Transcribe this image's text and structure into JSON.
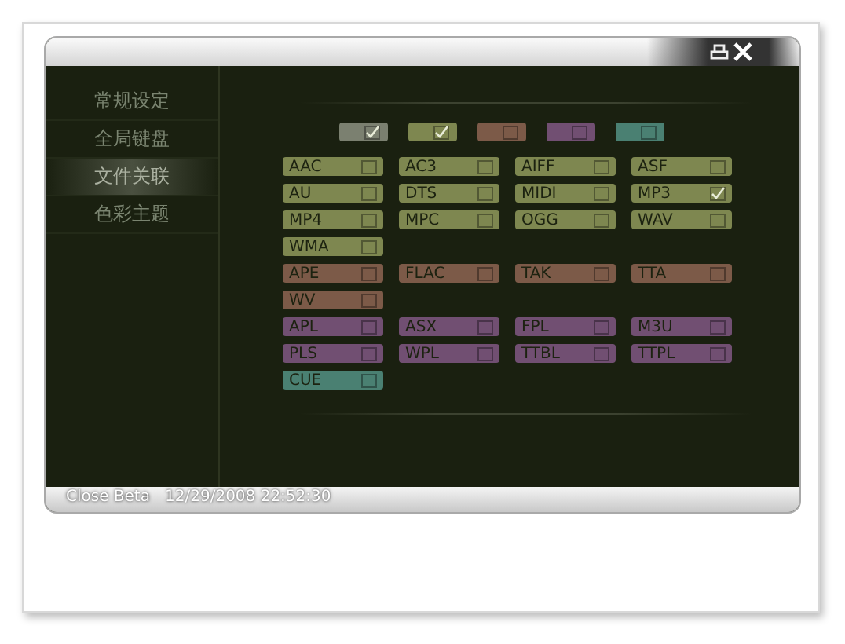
{
  "window": {
    "title_buttons": [
      {
        "kind": "restore"
      },
      {
        "kind": "close"
      }
    ]
  },
  "sidebar": {
    "items": [
      {
        "label": "常规设定",
        "selected": false
      },
      {
        "label": "全局键盘",
        "selected": false
      },
      {
        "label": "文件关联",
        "selected": true
      },
      {
        "label": "色彩主题",
        "selected": false
      }
    ]
  },
  "group_toggles": [
    {
      "color": "#7b8070",
      "checked": true
    },
    {
      "color": "#7e8750",
      "checked": true
    },
    {
      "color": "#7c5a48",
      "checked": false
    },
    {
      "color": "#714f72",
      "checked": false
    },
    {
      "color": "#4a8072",
      "checked": false
    }
  ],
  "groups": [
    {
      "color": "#7e8750",
      "items": [
        {
          "label": "AAC",
          "checked": false
        },
        {
          "label": "AC3",
          "checked": false
        },
        {
          "label": "AIFF",
          "checked": false
        },
        {
          "label": "ASF",
          "checked": false
        },
        {
          "label": "AU",
          "checked": false
        },
        {
          "label": "DTS",
          "checked": false
        },
        {
          "label": "MIDI",
          "checked": false
        },
        {
          "label": "MP3",
          "checked": true
        },
        {
          "label": "MP4",
          "checked": false
        },
        {
          "label": "MPC",
          "checked": false
        },
        {
          "label": "OGG",
          "checked": false
        },
        {
          "label": "WAV",
          "checked": false
        },
        {
          "label": "WMA",
          "checked": false
        }
      ]
    },
    {
      "color": "#7c5a48",
      "items": [
        {
          "label": "APE",
          "checked": false
        },
        {
          "label": "FLAC",
          "checked": false
        },
        {
          "label": "TAK",
          "checked": false
        },
        {
          "label": "TTA",
          "checked": false
        },
        {
          "label": "WV",
          "checked": false
        }
      ]
    },
    {
      "color": "#714f72",
      "items": [
        {
          "label": "APL",
          "checked": false
        },
        {
          "label": "ASX",
          "checked": false
        },
        {
          "label": "FPL",
          "checked": false
        },
        {
          "label": "M3U",
          "checked": false
        },
        {
          "label": "PLS",
          "checked": false
        },
        {
          "label": "WPL",
          "checked": false
        },
        {
          "label": "TTBL",
          "checked": false
        },
        {
          "label": "TTPL",
          "checked": false
        }
      ]
    },
    {
      "color": "#4a8072",
      "items": [
        {
          "label": "CUE",
          "checked": false
        }
      ]
    }
  ],
  "status_bar": {
    "text": "Close Beta   12/29/2008 22:52:30"
  }
}
